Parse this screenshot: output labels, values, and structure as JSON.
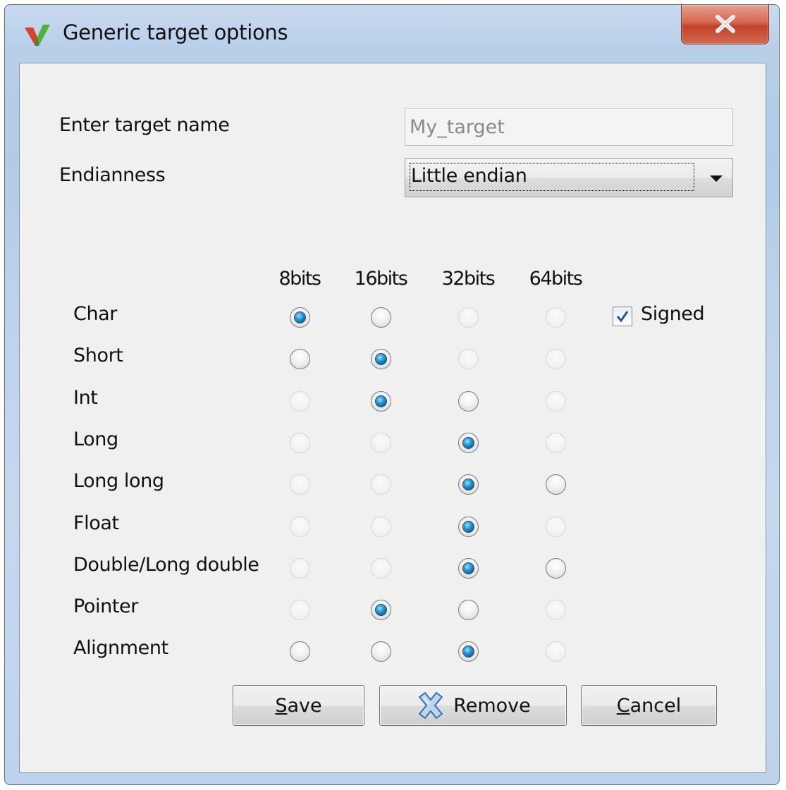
{
  "window": {
    "title": "Generic target options",
    "close_label": "X"
  },
  "form": {
    "target_name_label": "Enter target name",
    "target_name_placeholder": "My_target",
    "endianness_label": "Endianness",
    "endianness_value": "Little endian"
  },
  "columns": [
    "8bits",
    "16bits",
    "32bits",
    "64bits"
  ],
  "rows": [
    {
      "label": "Char",
      "options": [
        "checked",
        "enabled",
        "disabled",
        "disabled"
      ]
    },
    {
      "label": "Short",
      "options": [
        "enabled",
        "checked",
        "disabled",
        "disabled"
      ]
    },
    {
      "label": "Int",
      "options": [
        "disabled",
        "checked",
        "enabled",
        "disabled"
      ]
    },
    {
      "label": "Long",
      "options": [
        "disabled",
        "disabled",
        "checked",
        "disabled"
      ]
    },
    {
      "label": "Long long",
      "options": [
        "disabled",
        "disabled",
        "checked",
        "enabled"
      ]
    },
    {
      "label": "Float",
      "options": [
        "disabled",
        "disabled",
        "checked",
        "disabled"
      ]
    },
    {
      "label": "Double/Long double",
      "options": [
        "disabled",
        "disabled",
        "checked",
        "enabled"
      ]
    },
    {
      "label": "Pointer",
      "options": [
        "disabled",
        "checked",
        "enabled",
        "disabled"
      ]
    },
    {
      "label": "Alignment",
      "options": [
        "enabled",
        "enabled",
        "checked",
        "disabled"
      ]
    }
  ],
  "signed": {
    "label": "Signed",
    "checked": true
  },
  "buttons": {
    "save_mnemonic": "S",
    "save_rest": "ave",
    "remove": "Remove",
    "cancel_mnemonic": "C",
    "cancel_rest": "ancel"
  },
  "colors": {
    "accent": "#1a7bc4",
    "close_button": "#c9472d",
    "titlebar": "#c0d4ec"
  }
}
